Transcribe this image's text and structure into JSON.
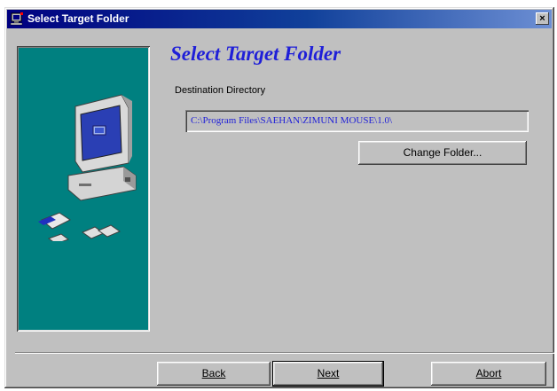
{
  "window": {
    "title": "Select Target Folder",
    "close_glyph": "×"
  },
  "main": {
    "heading": "Select Target Folder",
    "destination_label": "Destination Directory",
    "path_value": "C:\\Program Files\\SAEHAN\\ZIMUNI MOUSE\\1.0\\",
    "change_folder_label": "Change Folder..."
  },
  "footer": {
    "back_label": "Back",
    "next_label": "Next",
    "abort_label": "Abort"
  },
  "colors": {
    "title_bar": "#000080",
    "side_panel": "#008080",
    "heading": "#1f1fd8",
    "path_text": "#1f1fd8",
    "dialog_face": "#c0c0c0"
  },
  "icons": [
    "installer-app-icon",
    "close-icon",
    "computer-illustration"
  ]
}
